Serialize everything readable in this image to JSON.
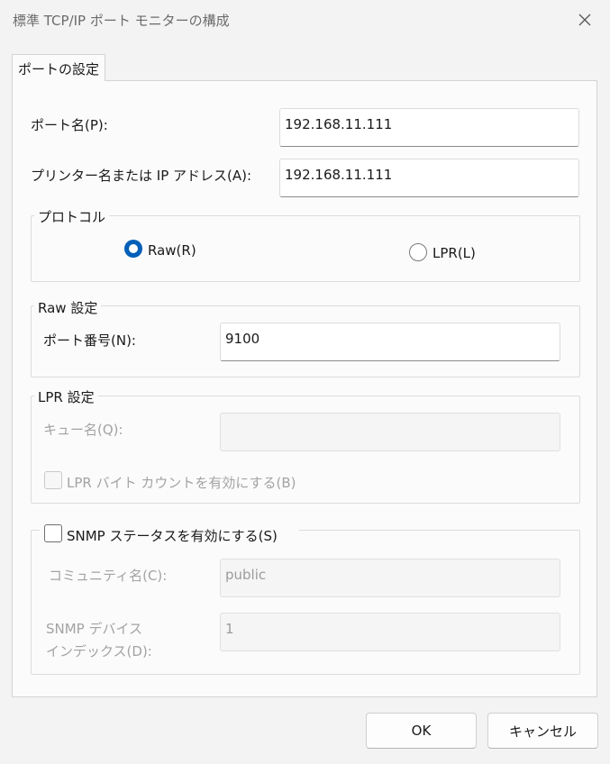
{
  "window": {
    "title": "標準 TCP/IP ポート モニターの構成",
    "close_icon": "close-icon"
  },
  "tab": {
    "label": "ポートの設定"
  },
  "port_name": {
    "label": "ポート名(P):",
    "value": "192.168.11.111"
  },
  "printer_address": {
    "label": "プリンター名または IP アドレス(A):",
    "value": "192.168.11.111"
  },
  "protocol": {
    "legend": "プロトコル",
    "raw_label": "Raw(R)",
    "raw_selected": true,
    "lpr_label": "LPR(L)",
    "lpr_selected": false
  },
  "raw_settings": {
    "legend": "Raw 設定",
    "port_number_label": "ポート番号(N):",
    "port_number_value": "9100"
  },
  "lpr_settings": {
    "legend": "LPR 設定",
    "queue_label": "キュー名(Q):",
    "queue_value": "",
    "byte_count_label": "LPR バイト カウントを有効にする(B)",
    "byte_count_checked": false
  },
  "snmp": {
    "enable_label": "SNMP ステータスを有効にする(S)",
    "enabled": false,
    "community_label": "コミュニティ名(C):",
    "community_value": "public",
    "device_index_label_line1": "SNMP デバイス",
    "device_index_label_line2": "インデックス(D):",
    "device_index_value": "1"
  },
  "buttons": {
    "ok": "OK",
    "cancel": "キャンセル"
  },
  "colors": {
    "accent": "#005fb8",
    "disabled_text": "#a3a3a3",
    "background": "#f3f3f3"
  }
}
